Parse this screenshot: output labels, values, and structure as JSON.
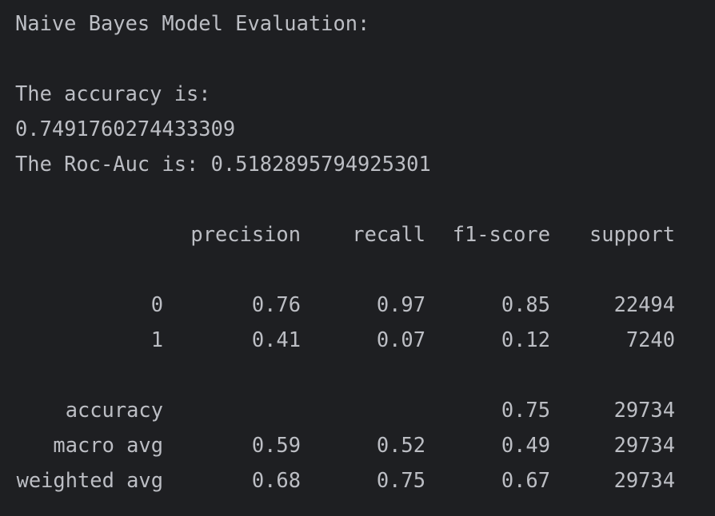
{
  "output": {
    "title": "Naive Bayes Model Evaluation:",
    "accuracy_label": "The accuracy is:",
    "accuracy_value": "0.7491760274433309",
    "roc_auc_line": "The Roc-Auc is: 0.5182895794925301"
  },
  "report": {
    "headers": [
      "precision",
      "recall",
      "f1-score",
      "support"
    ],
    "rows": [
      {
        "label": "0",
        "precision": "0.76",
        "recall": "0.97",
        "f1": "0.85",
        "support": "22494"
      },
      {
        "label": "1",
        "precision": "0.41",
        "recall": "0.07",
        "f1": "0.12",
        "support": "7240"
      }
    ],
    "summary": [
      {
        "label": "accuracy",
        "precision": "",
        "recall": "",
        "f1": "0.75",
        "support": "29734"
      },
      {
        "label": "macro avg",
        "precision": "0.59",
        "recall": "0.52",
        "f1": "0.49",
        "support": "29734"
      },
      {
        "label": "weighted avg",
        "precision": "0.68",
        "recall": "0.75",
        "f1": "0.67",
        "support": "29734"
      }
    ]
  },
  "theme": {
    "background": "#1e1f22",
    "text": "#bcbec4"
  }
}
